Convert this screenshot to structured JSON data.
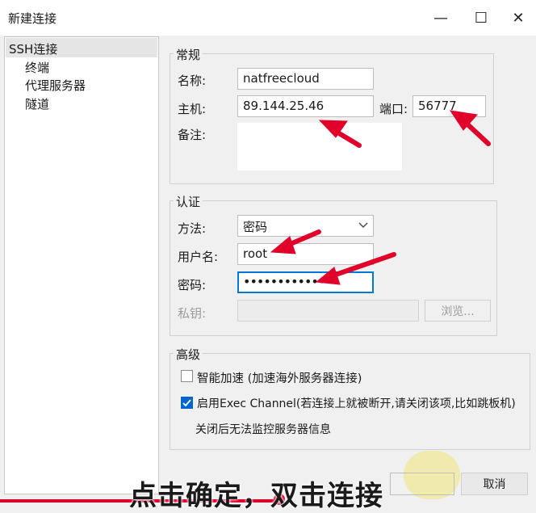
{
  "window": {
    "title": "新建连接",
    "minimize": "—",
    "maximize": "☐",
    "close": "✕"
  },
  "sidebar": {
    "items": [
      {
        "label": "SSH连接"
      },
      {
        "label": "终端"
      },
      {
        "label": "代理服务器"
      },
      {
        "label": "隧道"
      }
    ]
  },
  "general": {
    "title": "常规",
    "name_label": "名称:",
    "name_value": "natfreecloud",
    "host_label": "主机:",
    "host_value": "89.144.25.46",
    "port_label": "端口:",
    "port_value": "56777",
    "note_label": "备注:",
    "note_value": ""
  },
  "auth": {
    "title": "认证",
    "method_label": "方法:",
    "method_value": "密码",
    "user_label": "用户名:",
    "user_value": "root",
    "password_label": "密码:",
    "password_value": "•••••••••••••",
    "key_label": "私钥:",
    "key_value": "",
    "browse_label": "浏览..."
  },
  "advanced": {
    "title": "高级",
    "smart_accel_label": "智能加速 (加速海外服务器连接)",
    "smart_accel_checked": false,
    "exec_channel_label": "启用Exec Channel(若连接上就被断开,请关闭该项,比如跳板机)",
    "exec_channel_checked": true,
    "exec_channel_note": "关闭后无法监控服务器信息"
  },
  "footer": {
    "cancel_label": "取消"
  },
  "overlay": {
    "caption": "点击确定，双击连接"
  },
  "colors": {
    "accent": "#0066cc",
    "annotation": "#e1002a"
  }
}
